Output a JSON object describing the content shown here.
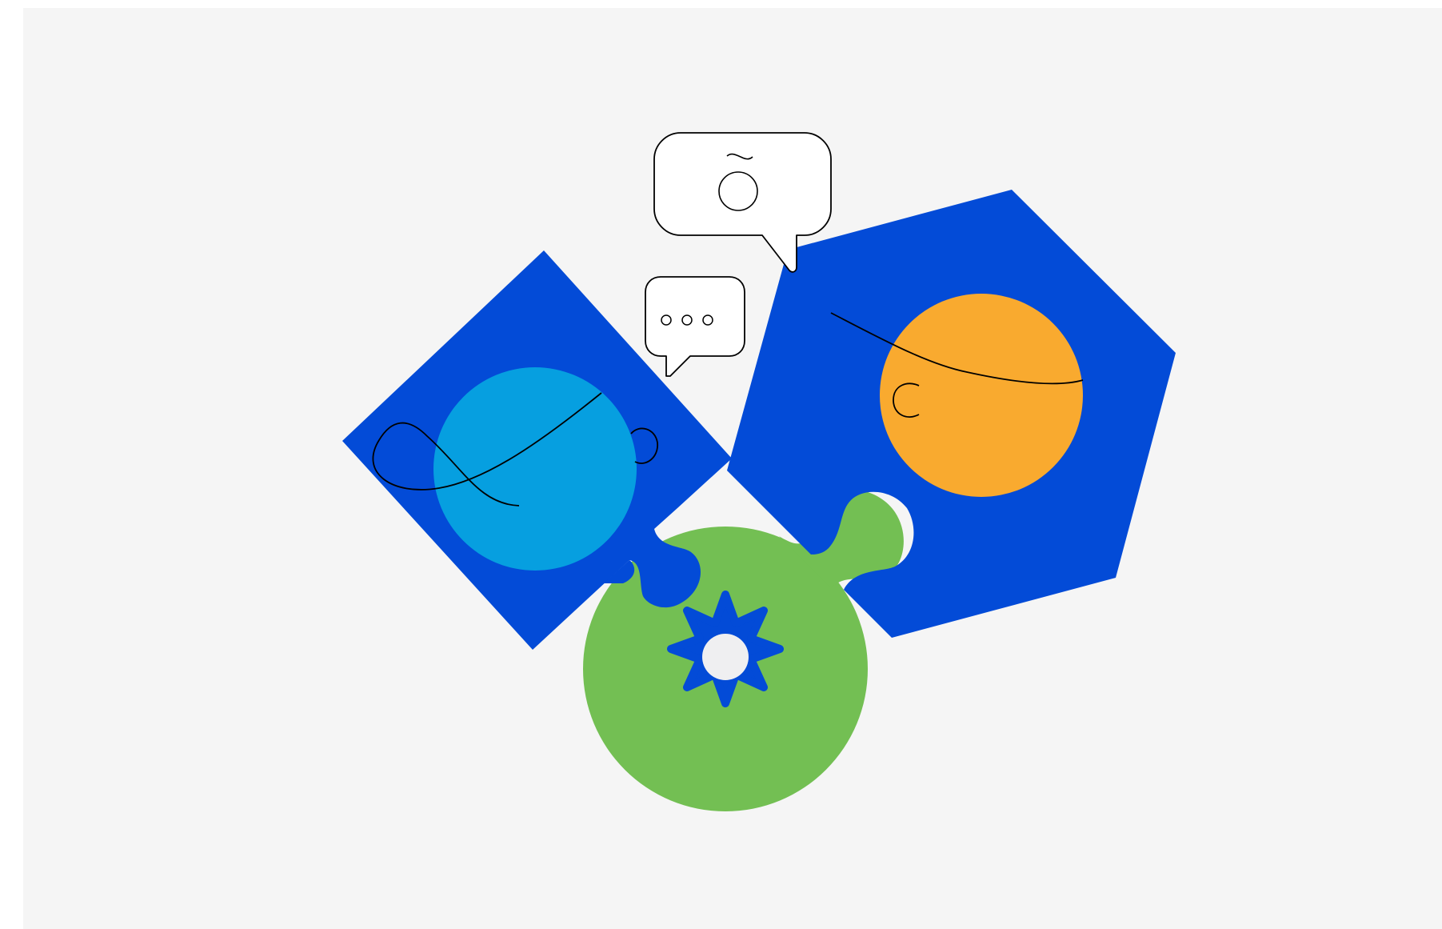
{
  "illustration": {
    "colors": {
      "panel_background": "#F5F5F5",
      "page_background": "#FFFFFF",
      "primary_blue": "#034BD7",
      "light_blue": "#069FE0",
      "orange": "#F9AA2F",
      "green": "#73BF53",
      "gear_hub": "#EFEFF1",
      "line": "#000000",
      "bubble_fill": "#FFFFFF"
    },
    "icons": [
      "diamond-puzzle-piece",
      "hexagon-puzzle-piece",
      "circle-puzzle-piece",
      "gear-icon",
      "speech-bubble-icon",
      "typing-bubble-icon",
      "ellipsis-icon"
    ]
  }
}
